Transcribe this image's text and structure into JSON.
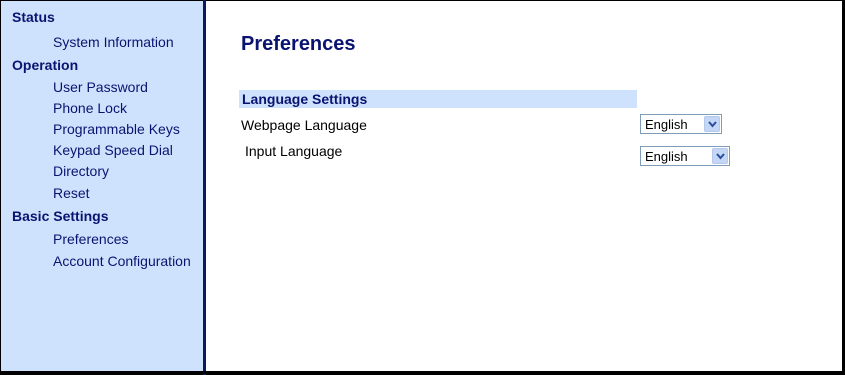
{
  "sidebar": {
    "sections": [
      {
        "label": "Status",
        "items": [
          {
            "label": "System Information"
          }
        ]
      },
      {
        "label": "Operation",
        "items": [
          {
            "label": "User Password"
          },
          {
            "label": "Phone Lock"
          },
          {
            "label": "Programmable Keys"
          },
          {
            "label": "Keypad Speed Dial"
          },
          {
            "label": "Directory"
          },
          {
            "label": "Reset"
          }
        ]
      },
      {
        "label": "Basic Settings",
        "items": [
          {
            "label": "Preferences"
          },
          {
            "label": "Account Configuration"
          }
        ]
      }
    ]
  },
  "main": {
    "title": "Preferences",
    "language_settings": {
      "header": "Language Settings",
      "webpage_language": {
        "label": "Webpage Language",
        "value": "English"
      },
      "input_language": {
        "label": "Input Language",
        "value": "English"
      }
    }
  },
  "colors": {
    "sidebar_bg": "#cfe2fd",
    "nav_text": "#0a1470",
    "divider": "#0a1a5c",
    "select_border": "#7f9db9",
    "select_button": "#c4d7f7"
  }
}
